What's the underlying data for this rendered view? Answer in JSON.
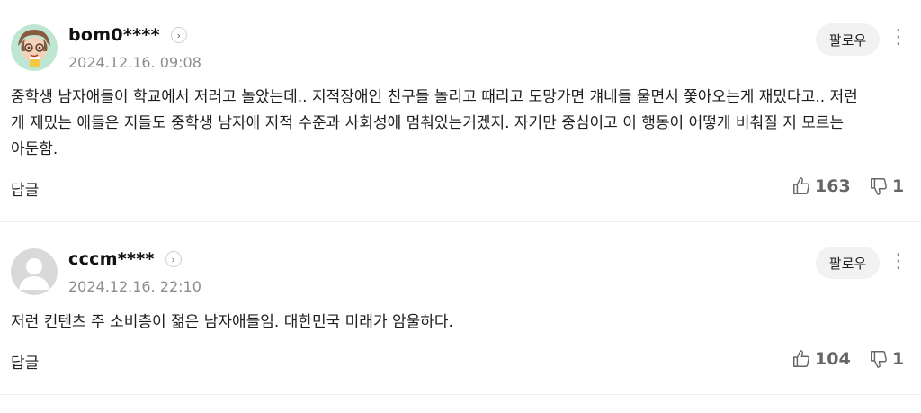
{
  "comments": [
    {
      "username": "bom0****",
      "date": "2024.12.16. 09:08",
      "follow_label": "팔로우",
      "more_icon": "more-vertical-icon",
      "text_lines": [
        "중학생 남자애들이 학교에서 저러고 놀았는데.. 지적장애인 친구들 놀리고 때리고 도망가면 걔네들 울면서 쫓아오는게 재밌다고.. 저런",
        "게 재밌는 애들은 지들도 중학생 남자애 지적 수준과 사회성에 멈춰있는거겠지. 자기만 중심이고 이 행동이 어떻게 비춰질 지 모르는",
        "아둔함."
      ],
      "reply_label": "답글",
      "likes": "163",
      "dislikes": "1"
    },
    {
      "username": "cccm****",
      "date": "2024.12.16. 22:10",
      "follow_label": "팔로우",
      "more_icon": "more-vertical-icon",
      "text_lines": [
        "저런 컨텐츠 주 소비층이 젊은 남자애들임. 대한민국 미래가 암울하다."
      ],
      "reply_label": "답글",
      "likes": "104",
      "dislikes": "1"
    }
  ]
}
